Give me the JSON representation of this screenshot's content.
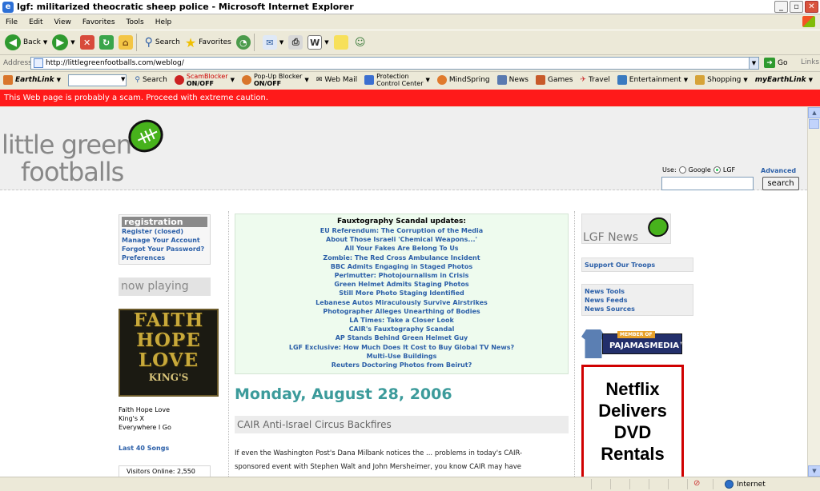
{
  "window": {
    "title": "lgf: militarized theocratic sheep police - Microsoft Internet Explorer"
  },
  "menu": [
    "File",
    "Edit",
    "View",
    "Favorites",
    "Tools",
    "Help"
  ],
  "toolbar": {
    "back": "Back",
    "search": "Search",
    "favorites": "Favorites"
  },
  "address": {
    "label": "Address",
    "url": "http://littlegreenfootballs.com/weblog/",
    "go": "Go",
    "links": "Links"
  },
  "earthlink": {
    "brand": "EarthLink",
    "search": "Search",
    "scamblocker": "ScamBlocker",
    "scamblocker_state": "ON/OFF",
    "popup": "Pop-Up Blocker",
    "popup_state": "ON/OFF",
    "webmail": "Web Mail",
    "protection1": "Protection",
    "protection2": "Control Center",
    "mindspring": "MindSpring",
    "news": "News",
    "games": "Games",
    "travel": "Travel",
    "entertainment": "Entertainment",
    "shopping": "Shopping",
    "myearthlink": "myEarthLink"
  },
  "warning": "This Web page is probably a scam. Proceed with extreme caution.",
  "site": {
    "logo_line1": "little green",
    "logo_line2": "footballs",
    "use_label": "Use:",
    "opt_google": "Google",
    "opt_lgf": "LGF",
    "selected": "LGF",
    "advanced": "Advanced",
    "search_button": "search"
  },
  "left": {
    "registration_title": "registration",
    "registration_links": [
      "Register (closed)",
      "Manage Your Account",
      "Forgot Your Password?",
      "Preferences"
    ],
    "now_playing": "now playing",
    "album_lines": [
      "FAITH",
      "HOPE",
      "LOVE",
      "KING'S"
    ],
    "song": [
      "Faith Hope Love",
      "King's X",
      "Everywhere I Go"
    ],
    "last40": "Last 40 Songs",
    "visitors": "Visitors Online: 2,550"
  },
  "center": {
    "faux_title": "Fauxtography Scandal updates:",
    "faux_links": [
      "EU Referendum: The Corruption of the Media",
      "About Those Israeli 'Chemical Weapons...'",
      "All Your Fakes Are Belong To Us",
      "Zombie: The Red Cross Ambulance Incident",
      "BBC Admits Engaging in Staged Photos",
      "Perlmutter: Photojournalism in Crisis",
      "Green Helmet Admits Staging Photos",
      "Still More Photo Staging Identified",
      "Lebanese Autos Miraculously Survive Airstrikes",
      "Photographer Alleges Unearthing of Bodies",
      "LA Times: Take a Closer Look",
      "CAIR's Fauxtography Scandal",
      "AP Stands Behind Green Helmet Guy",
      "LGF Exclusive: How Much Does It Cost to Buy Global TV News?",
      "Multi-Use Buildings",
      "Reuters Doctoring Photos from Beirut?"
    ],
    "date": "Monday, August 28, 2006",
    "post_title": "CAIR Anti-Israel Circus Backfires",
    "post_line1": "If even the Washington Post's Dana Milbank notices the ... problems in today's CAIR-",
    "post_line2": "sponsored event with Stephen Walt and John Mersheimer, you know CAIR may have"
  },
  "right": {
    "lgf_news": "LGF News",
    "support": "Support Our Troops",
    "news_links": [
      "News Tools",
      "News Feeds",
      "News Sources"
    ],
    "pj_member": "MEMBER OF",
    "pj_name": "PAJAMASMEDIA™",
    "ad_lines": [
      "Netflix",
      "Delivers",
      "DVD",
      "Rentals"
    ]
  },
  "status": {
    "zone": "Internet"
  },
  "colors": {
    "warning_bg": "#ff1a1a",
    "link": "#2b5fa8",
    "date": "#3c9b9b",
    "faux_bg": "#eefbee"
  }
}
